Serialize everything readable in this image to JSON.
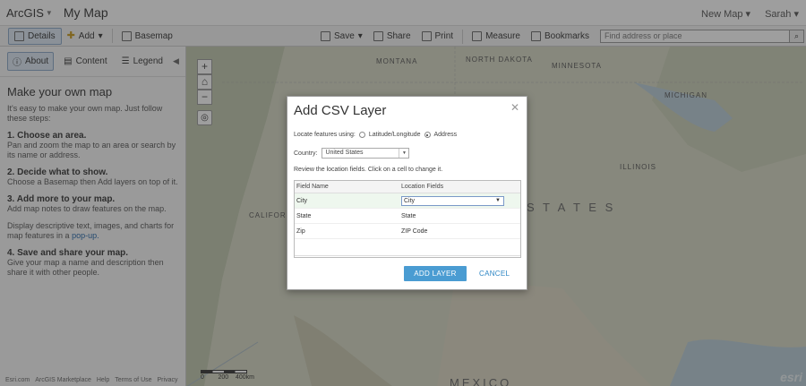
{
  "app": {
    "brand": "ArcGIS",
    "title": "My Map"
  },
  "topnav": {
    "new_map": "New Map",
    "user": "Sarah"
  },
  "toolbar": {
    "details": "Details",
    "add": "Add",
    "basemap": "Basemap",
    "save": "Save",
    "share": "Share",
    "print": "Print",
    "measure": "Measure",
    "bookmarks": "Bookmarks",
    "search_placeholder": "Find address or place"
  },
  "leftpanel": {
    "tabs": [
      "About",
      "Content",
      "Legend"
    ],
    "heading": "Make your own map",
    "intro": "It's easy to make your own map. Just follow these steps:",
    "steps": [
      {
        "title": "1. Choose an area.",
        "text": "Pan and zoom the map to an area or search by its name or address."
      },
      {
        "title": "2. Decide what to show.",
        "text": "Choose a Basemap then Add layers on top of it."
      },
      {
        "title": "3. Add more to your map.",
        "text": "Add map notes to draw features on the map."
      },
      {
        "title": "4. Save and share your map.",
        "text": "Give your map a name and description then share it with other people."
      }
    ],
    "extra": "Display descriptive text, images, and charts for map features in a",
    "extra_link": "pop-up.",
    "footer": [
      "Esri.com",
      "ArcGIS Marketplace",
      "Help",
      "Terms of Use",
      "Privacy"
    ]
  },
  "map": {
    "labels": {
      "montana": "MONTANA",
      "north_dakota": "NORTH DAKOTA",
      "minnesota": "MINNESOTA",
      "michigan": "MICHIGAN",
      "california": "CALIFORN",
      "illinois": "ILLINOIS",
      "united_states": "S T A T E S",
      "mexico": "MEXICO"
    },
    "scale": {
      "zero": "0",
      "mid": "200",
      "end": "400km"
    },
    "attribution": "esri"
  },
  "dialog": {
    "title": "Add CSV Layer",
    "locate_label": "Locate features using:",
    "option_latlong": "Latitude/Longitude",
    "option_address": "Address",
    "country_label": "Country:",
    "country_value": "United States",
    "hint": "Review the location fields. Click on a cell to change it.",
    "columns": [
      "Field Name",
      "Location Fields"
    ],
    "rows": [
      {
        "field": "City",
        "location": "City"
      },
      {
        "field": "State",
        "location": "State"
      },
      {
        "field": "Zip",
        "location": "ZIP Code"
      }
    ],
    "add_button": "ADD LAYER",
    "cancel_button": "CANCEL"
  }
}
